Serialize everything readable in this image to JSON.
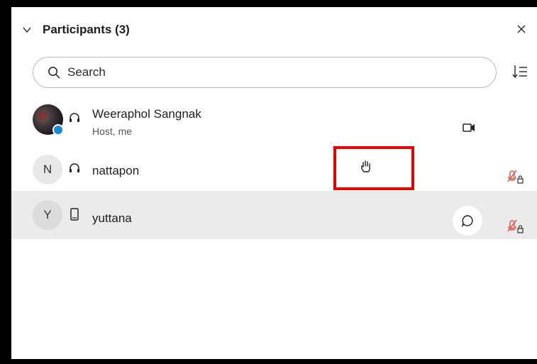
{
  "panel": {
    "title": "Participants (3)",
    "collapse_icon": "chevron-down-icon",
    "close_icon": "close-icon"
  },
  "search": {
    "placeholder": "Search",
    "value": "",
    "icon": "search-icon"
  },
  "sort_icon": "sort-icon",
  "participants": [
    {
      "name": "Weeraphol Sangnak",
      "role": "Host, me",
      "device_icon": "headphones-icon",
      "avatar": "photo",
      "video_icon": "video-camera-icon"
    },
    {
      "name": "nattapon",
      "avatar_letter": "N",
      "device_icon": "headphones-icon",
      "raised_hand_icon": "raised-hand-icon",
      "mic_status_icon": "mic-muted-locked-icon"
    },
    {
      "name": "yuttana",
      "avatar_letter": "Y",
      "device_icon": "mobile-phone-icon",
      "chat_icon": "chat-bubble-icon",
      "mic_status_icon": "mic-muted-locked-icon"
    }
  ],
  "colors": {
    "highlight_border": "#e60000",
    "muted_mic": "#e05a4b",
    "selected_row": "#ebebeb"
  }
}
